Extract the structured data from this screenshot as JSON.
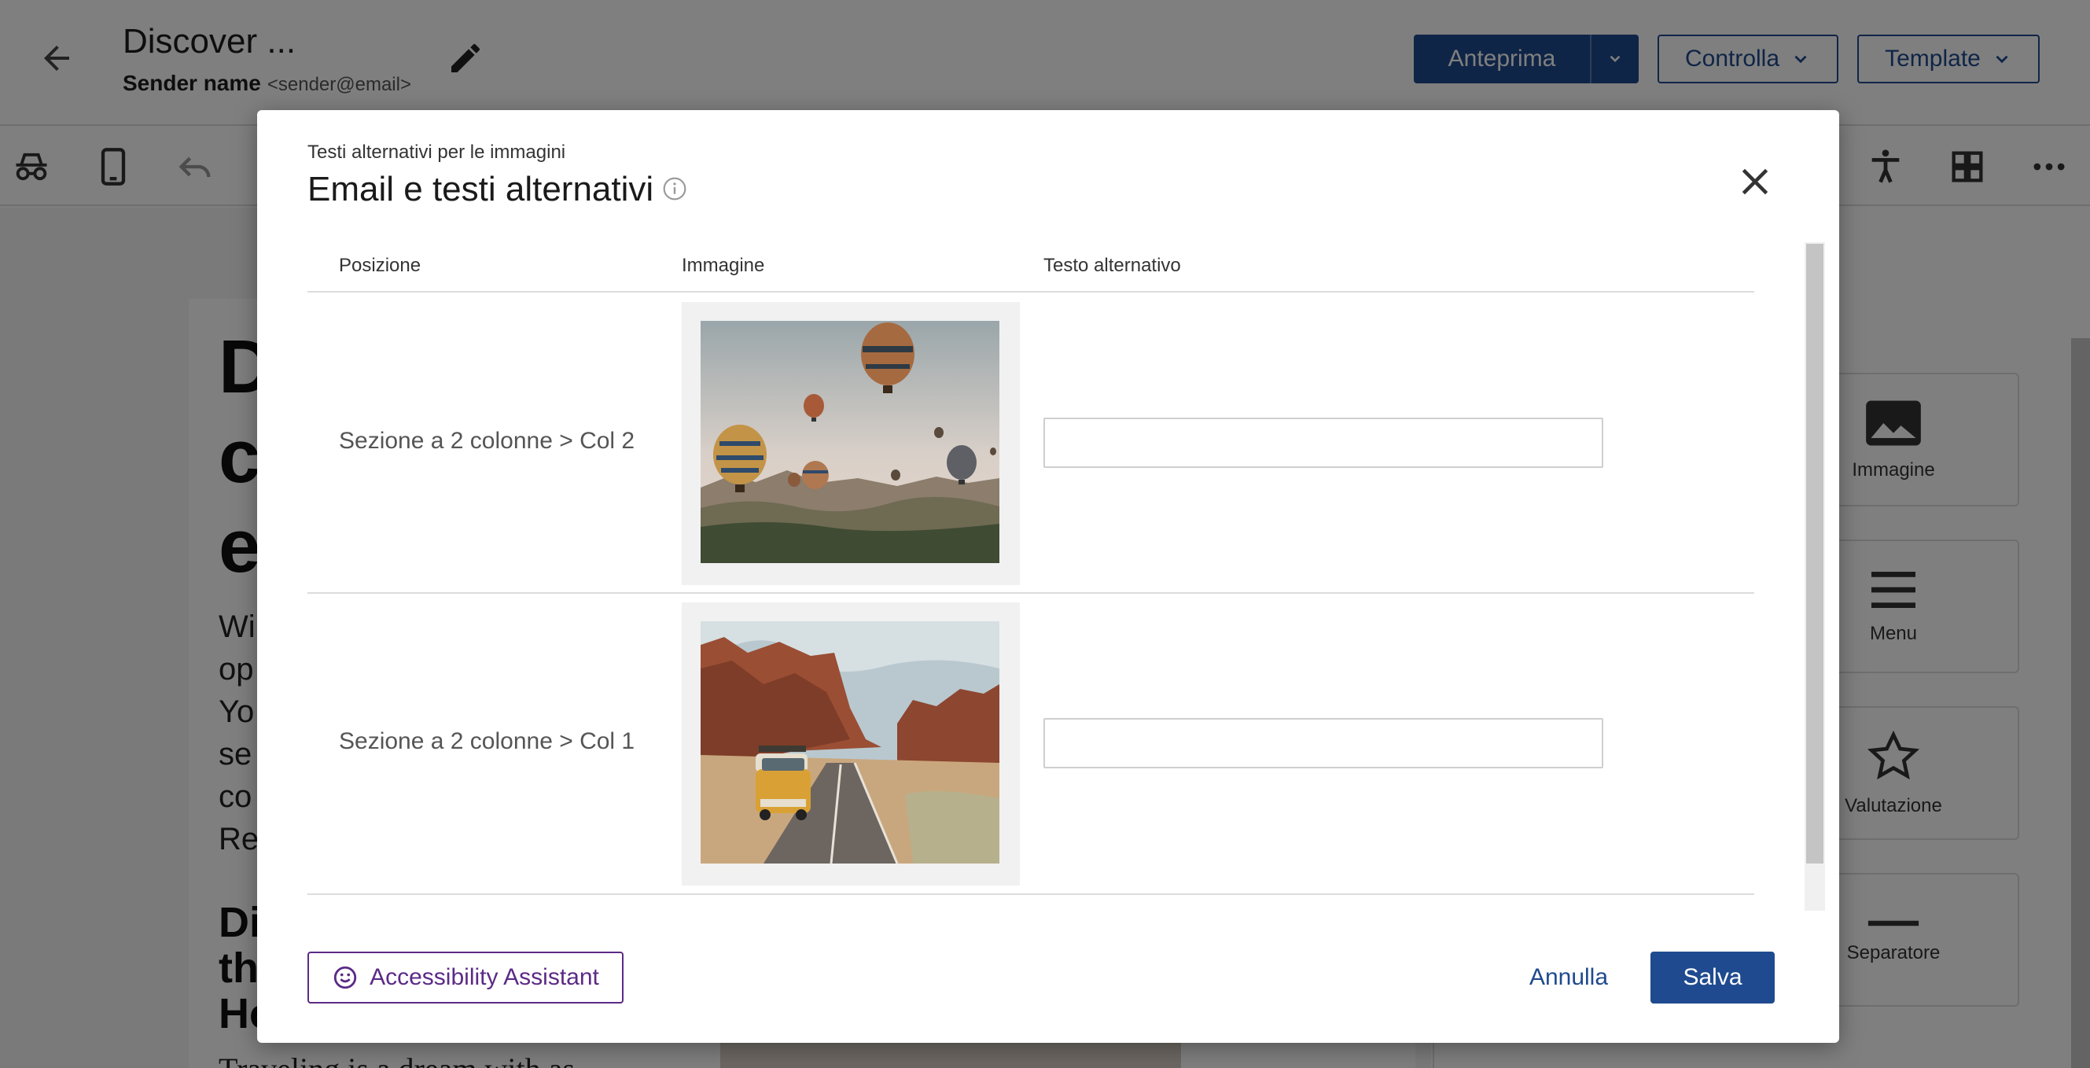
{
  "editor": {
    "title": "Discover ...",
    "sender_name": "Sender name",
    "sender_email": "<sender@email>",
    "preview_label": "Anteprima",
    "check_label": "Controlla",
    "template_label": "Template"
  },
  "canvas": {
    "heading_fragment": "D\nc\ne",
    "body_fragment": "Wi\nop\nYo\nse\nco\nRe",
    "subheading_fragment": "Di\nth\nHo",
    "snippet": "Traveling is a dream with as"
  },
  "blocks": [
    {
      "label": "Immagine",
      "icon": "image-icon"
    },
    {
      "label": "Menu",
      "icon": "menu-icon"
    },
    {
      "label": "Valutazione",
      "icon": "star-icon"
    },
    {
      "label": "Separatore",
      "icon": "divider-icon"
    }
  ],
  "modal": {
    "subtitle": "Testi alternativi per le immagini",
    "title": "Email e testi alternativi",
    "columns": {
      "position": "Posizione",
      "image": "Immagine",
      "alt_text": "Testo alternativo"
    },
    "rows": [
      {
        "position": "Sezione a 2 colonne > Col 2",
        "image": "hot-air-balloons",
        "alt_value": ""
      },
      {
        "position": "Sezione a 2 colonne > Col 1",
        "image": "yellow-van-desert-road",
        "alt_value": ""
      }
    ],
    "accessibility_label": "Accessibility Assistant",
    "cancel_label": "Annulla",
    "save_label": "Salva"
  },
  "colors": {
    "primary": "#1f4a8f",
    "accent_purple": "#5b2a86",
    "overlay": "rgba(0,0,0,0.5)"
  }
}
